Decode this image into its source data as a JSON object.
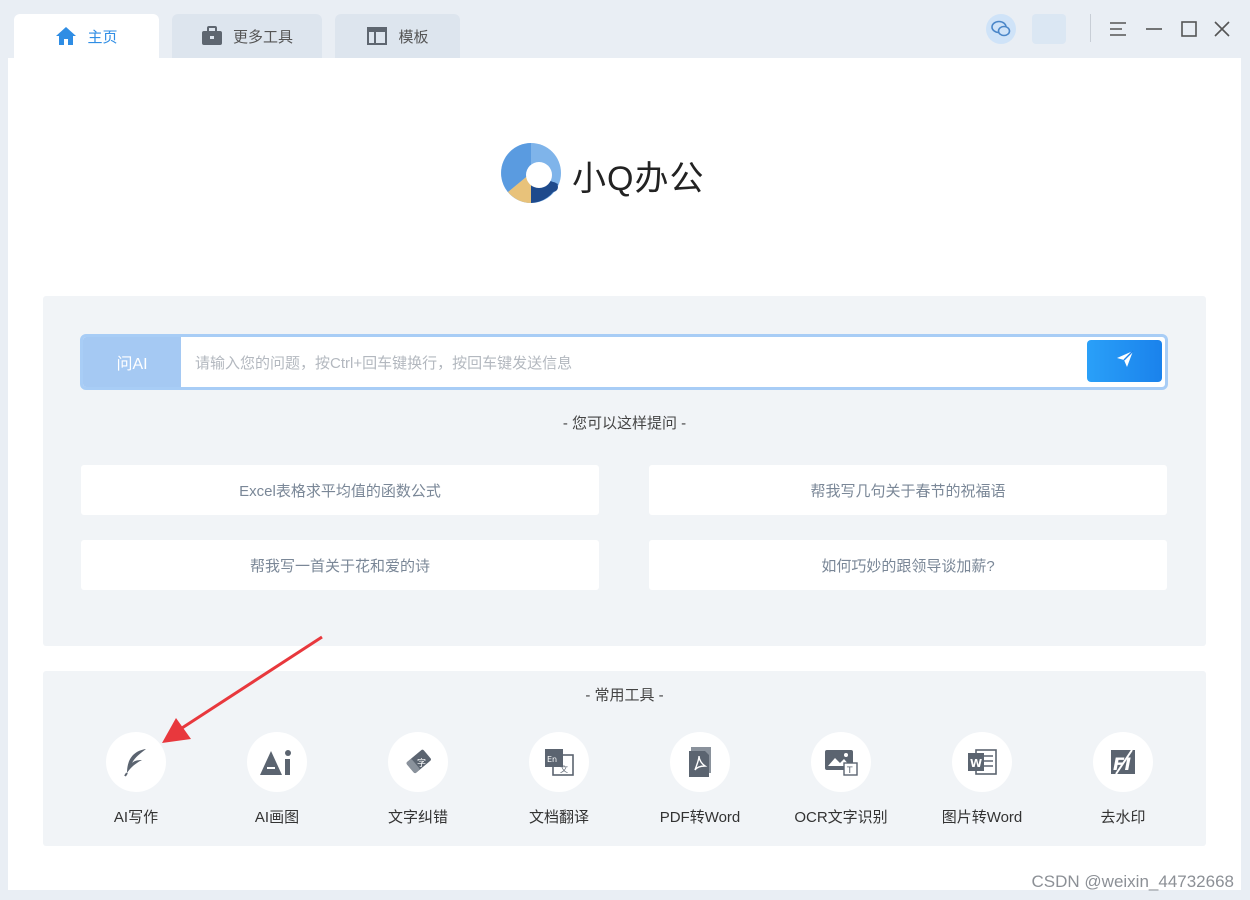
{
  "tabs": [
    {
      "label": "主页",
      "icon": "home-icon",
      "active": true
    },
    {
      "label": "更多工具",
      "icon": "briefcase-icon",
      "active": false
    },
    {
      "label": "模板",
      "icon": "template-icon",
      "active": false
    }
  ],
  "window_controls": {
    "wechat_icon": "wechat-icon",
    "menu_icon": "menu-icon",
    "minimize_icon": "minimize-icon",
    "maximize_icon": "maximize-icon",
    "close_icon": "close-icon"
  },
  "logo": {
    "brand": "小Q办公",
    "icon": "q-logo-icon"
  },
  "ask": {
    "label": "问AI",
    "placeholder": "请输入您的问题，按Ctrl+回车键换行，按回车键发送信息",
    "value": "",
    "send_icon": "send-icon"
  },
  "suggestions": {
    "title": "- 您可以这样提问 -",
    "items": [
      "Excel表格求平均值的函数公式",
      "帮我写几句关于春节的祝福语",
      "帮我写一首关于花和爱的诗",
      "如何巧妙的跟领导谈加薪?"
    ]
  },
  "tools": {
    "title": "- 常用工具 -",
    "items": [
      {
        "label": "AI写作",
        "icon": "feather-icon"
      },
      {
        "label": "AI画图",
        "icon": "ai-paint-icon"
      },
      {
        "label": "文字纠错",
        "icon": "eraser-icon"
      },
      {
        "label": "文档翻译",
        "icon": "translate-icon"
      },
      {
        "label": "PDF转Word",
        "icon": "pdf-icon"
      },
      {
        "label": "OCR文字识别",
        "icon": "ocr-icon"
      },
      {
        "label": "图片转Word",
        "icon": "word-icon"
      },
      {
        "label": "去水印",
        "icon": "watermark-remove-icon"
      }
    ]
  },
  "watermark": "CSDN @weixin_44732668",
  "colors": {
    "accent": "#2f8de4",
    "ask_label_bg": "#a5c9f3",
    "send_button": "#1a82ec",
    "arrow": "#e8383d"
  }
}
